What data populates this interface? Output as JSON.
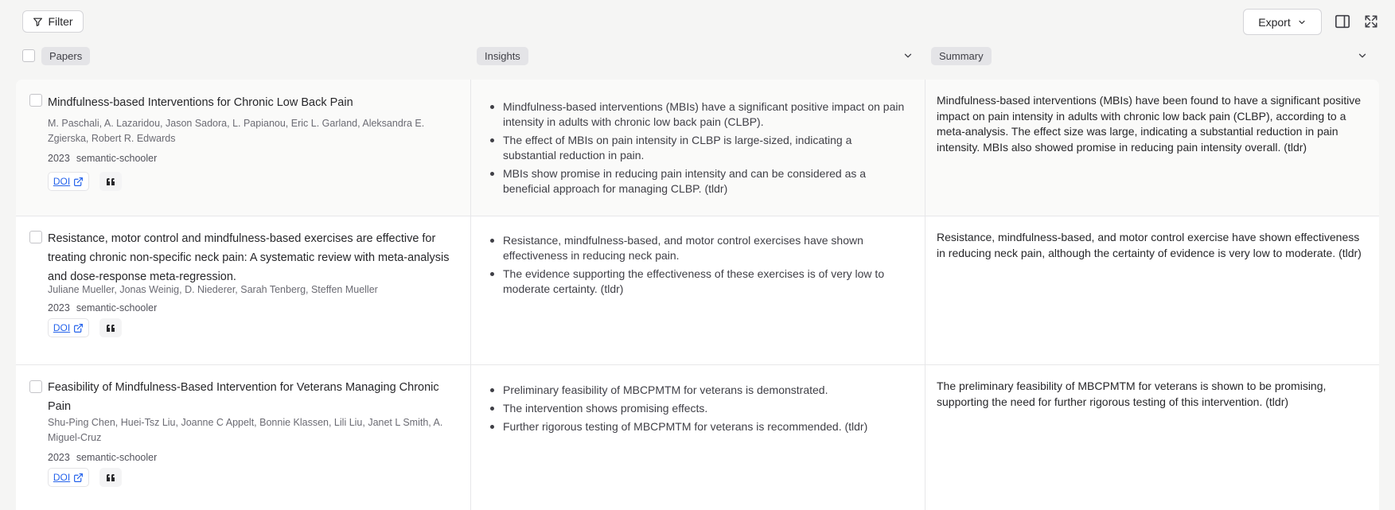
{
  "toolbar": {
    "filter_label": "Filter",
    "export_label": "Export"
  },
  "columns": {
    "papers": "Papers",
    "insights": "Insights",
    "summary": "Summary"
  },
  "rows": [
    {
      "title": "Mindfulness-based Interventions for Chronic Low Back Pain",
      "authors": "M. Paschali, A. Lazaridou, Jason Sadora, L. Papianou, Eric L. Garland, Aleksandra E. Zgierska, Robert R. Edwards",
      "year": "2023",
      "source": "semantic-schooler",
      "doi_label": "DOI",
      "insights": [
        "Mindfulness-based interventions (MBIs) have a significant positive impact on pain intensity in adults with chronic low back pain (CLBP).",
        "The effect of MBIs on pain intensity in CLBP is large-sized, indicating a substantial reduction in pain.",
        "MBIs show promise in reducing pain intensity and can be considered as a beneficial approach for managing CLBP. (tldr)"
      ],
      "summary": "Mindfulness-based interventions (MBIs) have been found to have a significant positive impact on pain intensity in adults with chronic low back pain (CLBP), according to a meta-analysis. The effect size was large, indicating a substantial reduction in pain intensity. MBIs also showed promise in reducing pain intensity overall. (tldr)"
    },
    {
      "title": "Resistance, motor control and mindfulness-based exercises are effective for treating chronic non-specific neck pain: A systematic review with meta-analysis and dose-response meta-regression.",
      "authors": "Juliane Mueller, Jonas Weinig, D. Niederer, Sarah Tenberg, Steffen Mueller",
      "year": "2023",
      "source": "semantic-schooler",
      "doi_label": "DOI",
      "insights": [
        "Resistance, mindfulness-based, and motor control exercises have shown effectiveness in reducing neck pain.",
        "The evidence supporting the effectiveness of these exercises is of very low to moderate certainty. (tldr)"
      ],
      "summary": "Resistance, mindfulness-based, and motor control exercise have shown effectiveness in reducing neck pain, although the certainty of evidence is very low to moderate. (tldr)"
    },
    {
      "title": "Feasibility of Mindfulness-Based Intervention for Veterans Managing Chronic Pain",
      "authors": "Shu-Ping Chen, Huei-Tsz Liu, Joanne C Appelt, Bonnie Klassen, Lili Liu, Janet L Smith, A. Miguel-Cruz",
      "year": "2023",
      "source": "semantic-schooler",
      "doi_label": "DOI",
      "insights": [
        "Preliminary feasibility of MBCPMTM for veterans is demonstrated.",
        "The intervention shows promising effects.",
        "Further rigorous testing of MBCPMTM for veterans is recommended. (tldr)"
      ],
      "summary": "The preliminary feasibility of MBCPMTM for veterans is shown to be promising, supporting the need for further rigorous testing of this intervention. (tldr)"
    }
  ],
  "icons": {
    "filter": "filter-icon",
    "export_chevron": "chevron-down-icon",
    "panel": "sidebar-panel-icon",
    "expand": "expand-icon",
    "doi_external": "external-link-icon",
    "cite": "quote-icon"
  },
  "colors": {
    "link": "#2563eb",
    "background": "#f5f5f4",
    "chip": "#e4e4e7"
  }
}
